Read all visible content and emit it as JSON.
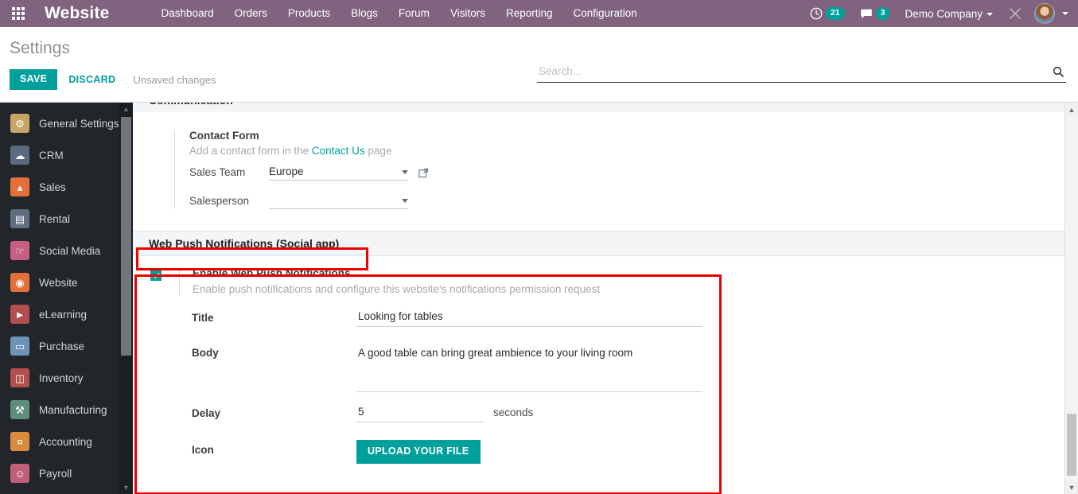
{
  "navbar": {
    "apps_icon": "apps-grid-icon",
    "brand": "Website",
    "menu": [
      {
        "label": "Dashboard"
      },
      {
        "label": "Orders"
      },
      {
        "label": "Products"
      },
      {
        "label": "Blogs"
      },
      {
        "label": "Forum"
      },
      {
        "label": "Visitors"
      },
      {
        "label": "Reporting"
      },
      {
        "label": "Configuration"
      }
    ],
    "activity": {
      "icon": "clock-activity-icon",
      "count": "21"
    },
    "messages": {
      "icon": "chat-bubble-icon",
      "count": "3"
    },
    "company": "Demo Company",
    "debug_icon": "wrench-screwdriver-icon",
    "avatar_icon": "user-avatar",
    "accent": "#00a09d",
    "navbar_bg": "#80637e"
  },
  "control_panel": {
    "title": "Settings",
    "save_label": "SAVE",
    "discard_label": "DISCARD",
    "status": "Unsaved changes",
    "search": {
      "placeholder": "Search...",
      "value": "",
      "icon": "search-icon"
    }
  },
  "sidebar": {
    "items": [
      {
        "label": "General Settings",
        "icon": "gear-icon",
        "color": "#c6a667",
        "glyph": "⚙"
      },
      {
        "label": "CRM",
        "icon": "handshake-icon",
        "color": "#5a6a80",
        "glyph": "✋"
      },
      {
        "label": "Sales",
        "icon": "chart-line-icon",
        "color": "#e2703a",
        "glyph": "↗"
      },
      {
        "label": "Rental",
        "icon": "calendar-icon",
        "color": "#5f6d80",
        "glyph": "▤"
      },
      {
        "label": "Social Media",
        "icon": "thumbs-up-icon",
        "color": "#c75f83",
        "glyph": "☝"
      },
      {
        "label": "Website",
        "icon": "globe-icon",
        "color": "#e2703a",
        "glyph": "◔"
      },
      {
        "label": "eLearning",
        "icon": "graduation-icon",
        "color": "#b34f4f",
        "glyph": "▶"
      },
      {
        "label": "Purchase",
        "icon": "credit-card-icon",
        "color": "#6f92b8",
        "glyph": "▭"
      },
      {
        "label": "Inventory",
        "icon": "box-icon",
        "color": "#b34f4f",
        "glyph": "▧"
      },
      {
        "label": "Manufacturing",
        "icon": "wrench-icon",
        "color": "#5f8f7a",
        "glyph": "⚒"
      },
      {
        "label": "Accounting",
        "icon": "invoice-icon",
        "color": "#d98c3f",
        "glyph": "¤"
      },
      {
        "label": "Payroll",
        "icon": "employee-icon",
        "color": "#c05f7a",
        "glyph": "☺"
      }
    ]
  },
  "main": {
    "clipped_section": "Communication",
    "contact_form": {
      "title": "Contact Form",
      "description_pre": "Add a contact form in the ",
      "description_link": "Contact Us",
      "description_post": " page",
      "sales_team_label": "Sales Team",
      "sales_team_value": "Europe",
      "salesperson_label": "Salesperson",
      "salesperson_value": "",
      "external_link_icon": "external-link-icon"
    },
    "push_section": {
      "band_title": "Web Push Notifications (Social app)",
      "checkbox_checked": true,
      "enable_title": "Enable Web Push Notifications",
      "enable_desc": "Enable push notifications and configure this website's notifications permission request",
      "fields": {
        "title_label": "Title",
        "title_value": "Looking for tables",
        "body_label": "Body",
        "body_value": "A good table can bring great ambience to your living room",
        "delay_label": "Delay",
        "delay_value": "5",
        "delay_suffix": "seconds",
        "icon_label": "Icon",
        "upload_label": "UPLOAD YOUR FILE"
      }
    }
  },
  "annotations": {
    "highlight_color": "#ee0000",
    "boxes": [
      "web-push-section-header",
      "web-push-settings-block"
    ]
  }
}
